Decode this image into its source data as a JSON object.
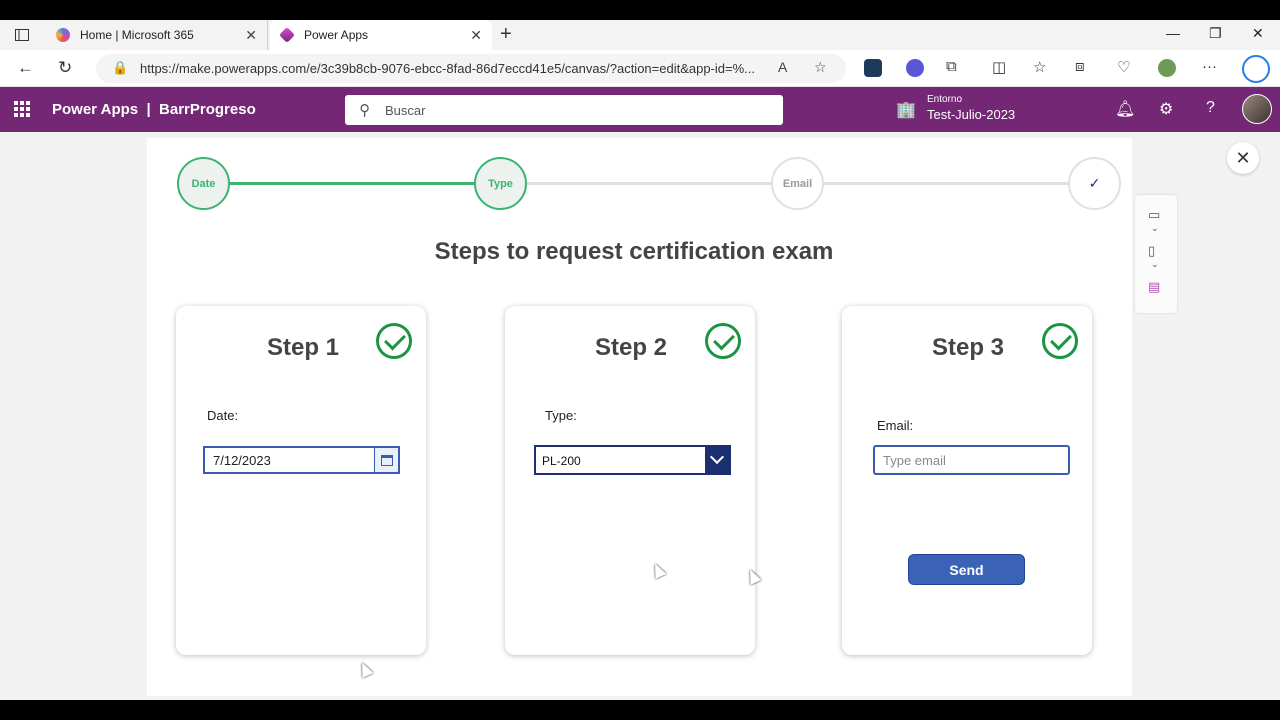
{
  "browser": {
    "tabs": [
      {
        "label": "Home | Microsoft 365"
      },
      {
        "label": "Power Apps"
      }
    ],
    "url": "https://make.powerapps.com/e/3c39b8cb-9076-ebcc-8fad-86d7eccd41e5/canvas/?action=edit&app-id=%..."
  },
  "header": {
    "app_name": "Power Apps",
    "separator": "|",
    "project": "BarrProgreso",
    "search_placeholder": "Buscar",
    "env_label": "Entorno",
    "env_name": "Test-Julio-2023"
  },
  "progress": {
    "steps": [
      {
        "label": "Date",
        "state": "done"
      },
      {
        "label": "Type",
        "state": "done"
      },
      {
        "label": "Email",
        "state": "todo"
      },
      {
        "label": "✓",
        "state": "todo"
      }
    ],
    "accent": "#3cb371"
  },
  "main": {
    "title": "Steps to request certification exam"
  },
  "cards": {
    "step1": {
      "title": "Step 1",
      "field_label": "Date:",
      "value": "7/12/2023"
    },
    "step2": {
      "title": "Step 2",
      "field_label": "Type:",
      "value": "PL-200"
    },
    "step3": {
      "title": "Step 3",
      "field_label": "Email:",
      "placeholder": "Type email",
      "button": "Send"
    }
  },
  "colors": {
    "header_bg": "#742774",
    "check_green": "#1a9642",
    "button_blue": "#3a63b8"
  }
}
